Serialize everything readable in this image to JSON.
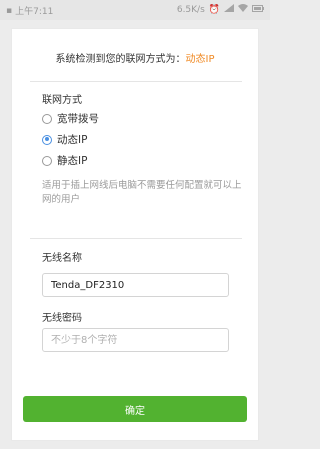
{
  "status_bar": {
    "time": "上午7:11",
    "network_speed": "6.5K/s",
    "icons": [
      "alarm-icon",
      "signal-icon",
      "wifi-icon",
      "battery-icon"
    ]
  },
  "detection": {
    "prefix": "系统检测到您的联网方式为：",
    "value": "动态IP"
  },
  "connection": {
    "label": "联网方式",
    "options": [
      {
        "label": "宽带拨号",
        "selected": false
      },
      {
        "label": "动态IP",
        "selected": true
      },
      {
        "label": "静态IP",
        "selected": false
      }
    ],
    "hint": "适用于插上网线后电脑不需要任何配置就可以上网的用户"
  },
  "wireless_name": {
    "label": "无线名称",
    "value": "Tenda_DF2310"
  },
  "wireless_password": {
    "label": "无线密码",
    "placeholder": "不少于8个字符"
  },
  "confirm_label": "确定",
  "colors": {
    "accent_orange": "#f08a24",
    "radio_blue": "#4a90e2",
    "button_green": "#52b230"
  }
}
